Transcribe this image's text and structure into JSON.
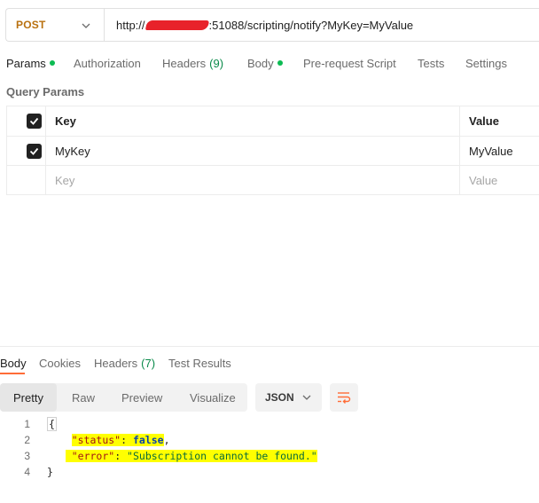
{
  "request": {
    "method": "POST",
    "url_prefix": "http://",
    "url_suffix": ":51088/scripting/notify?MyKey=MyValue"
  },
  "request_tabs": [
    {
      "label": "Params",
      "dot": true
    },
    {
      "label": "Authorization"
    },
    {
      "label": "Headers",
      "count": "(9)"
    },
    {
      "label": "Body",
      "dot": true
    },
    {
      "label": "Pre-request Script"
    },
    {
      "label": "Tests"
    },
    {
      "label": "Settings"
    }
  ],
  "query_params": {
    "title": "Query Params",
    "header": {
      "key": "Key",
      "value": "Value"
    },
    "rows": [
      {
        "key": "MyKey",
        "value": "MyValue",
        "checked": true
      }
    ],
    "placeholder": {
      "key": "Key",
      "value": "Value"
    }
  },
  "response_tabs": [
    {
      "label": "Body"
    },
    {
      "label": "Cookies"
    },
    {
      "label": "Headers",
      "count": "(7)"
    },
    {
      "label": "Test Results"
    }
  ],
  "format_buttons": [
    "Pretty",
    "Raw",
    "Preview",
    "Visualize"
  ],
  "format_select": "JSON",
  "code_lines": {
    "numbers": [
      "1",
      "2",
      "3",
      "4"
    ],
    "open_brace": "{",
    "status_key": "\"status\"",
    "status_value": "false",
    "error_key": "\"error\"",
    "error_value": "\"Subscription cannot be found.\"",
    "close_brace": "}"
  },
  "colors": {
    "accent": "#ff6c37",
    "method": "#b9710f",
    "dot": "#0cbb52",
    "highlight": "#ffff00"
  },
  "icons": [
    "chevron-down-icon",
    "checkbox-checked-icon",
    "wrap-lines-icon"
  ]
}
